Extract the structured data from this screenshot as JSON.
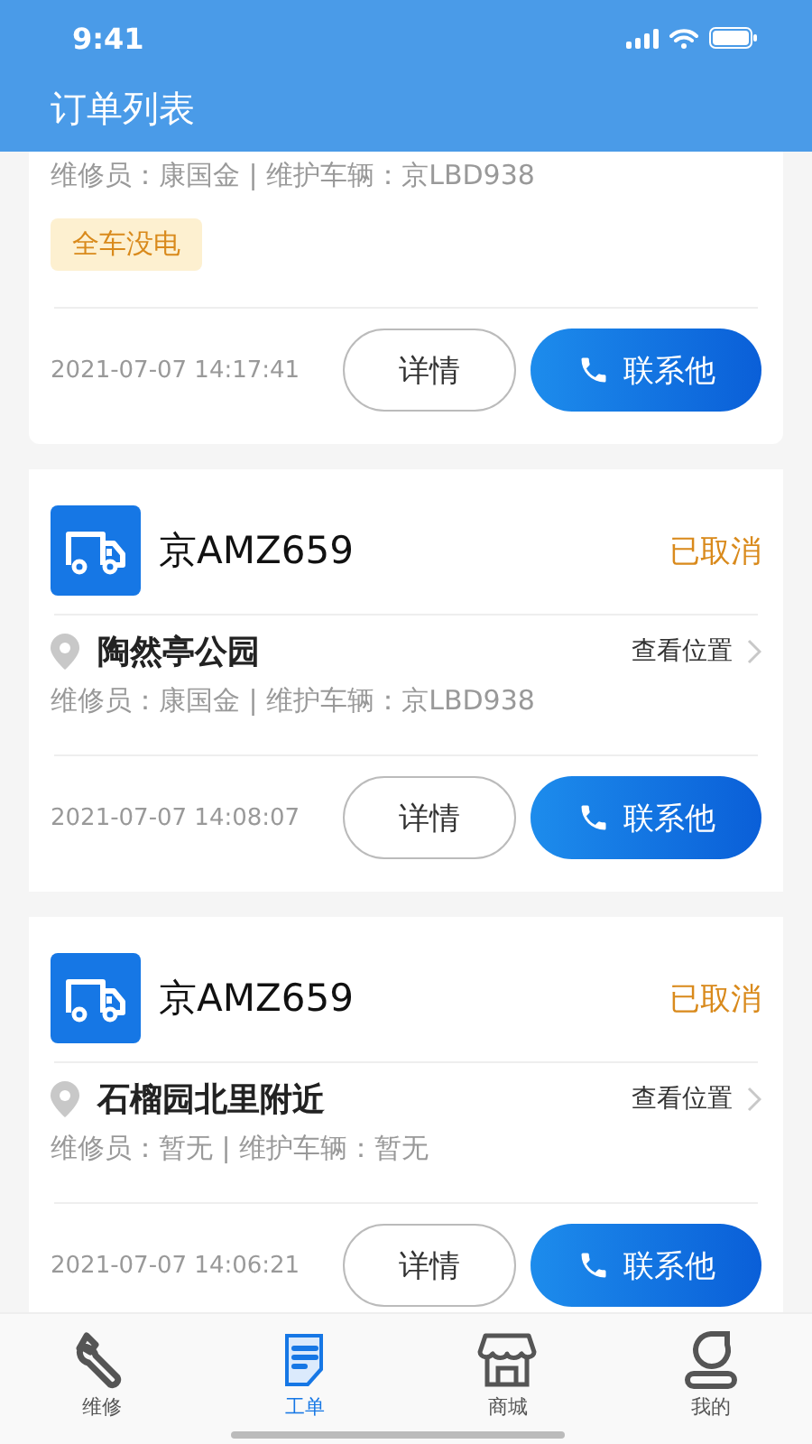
{
  "status_bar": {
    "time": "9:41"
  },
  "title": "订单列表",
  "orders": [
    {
      "meta": "维修员：康国金 | 维护车辆：京LBD938",
      "tag": "全车没电",
      "time": "2021-07-07 14:17:41",
      "detail_button": "详情",
      "call_button": "联系他"
    },
    {
      "plate": "京AMZ659",
      "status": "已取消",
      "location": "陶然亭公园",
      "view_location": "查看位置",
      "meta": "维修员：康国金 | 维护车辆：京LBD938",
      "time": "2021-07-07 14:08:07",
      "detail_button": "详情",
      "call_button": "联系他"
    },
    {
      "plate": "京AMZ659",
      "status": "已取消",
      "location": "石榴园北里附近",
      "view_location": "查看位置",
      "meta": "维修员：暂无 | 维护车辆：暂无",
      "time": "2021-07-07 14:06:21",
      "detail_button": "详情",
      "call_button": "联系他"
    }
  ],
  "tabs": [
    {
      "label": "维修",
      "kind": "wrench",
      "selected": false
    },
    {
      "label": "工单",
      "kind": "document",
      "selected": true
    },
    {
      "label": "商城",
      "kind": "shop",
      "selected": false
    },
    {
      "label": "我的",
      "kind": "person",
      "selected": false
    }
  ]
}
